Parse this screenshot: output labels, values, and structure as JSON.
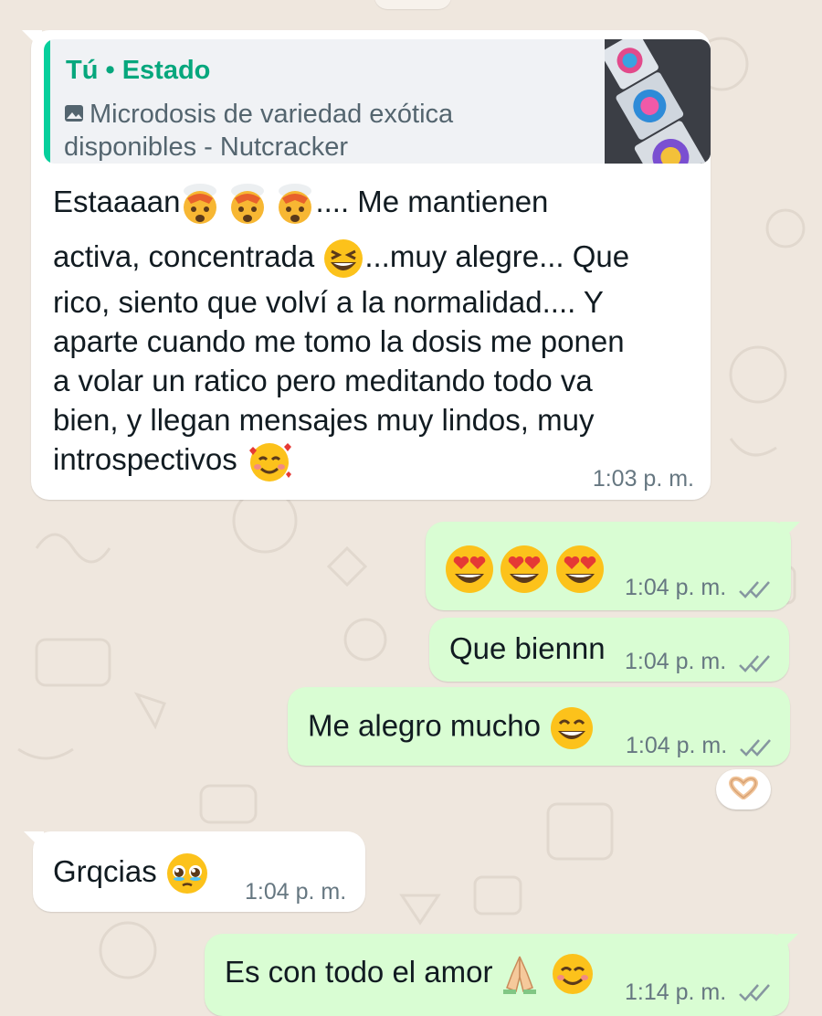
{
  "messages": {
    "m1": {
      "quote_author": "Tú • Estado",
      "quote_text_line1": "Microdosis de variedad exótica",
      "quote_text_line2": "disponibles - Nutcracker",
      "line1_a": "Estaaaan",
      "line1_b": ".... Me mantienen",
      "line2_a": "activa, concentrada ",
      "line2_b": "...muy alegre... Que",
      "line3": "rico, siento que volví a la normalidad.... Y",
      "line4": "aparte cuando me tomo la dosis me ponen",
      "line5": "a volar un ratico pero meditando todo va",
      "line6": "bien, y llegan mensajes muy lindos, muy",
      "line7": "introspectivos ",
      "time": "1:03 p. m."
    },
    "m2": {
      "time": "1:04 p. m."
    },
    "m3": {
      "text": "Que biennn",
      "time": "1:04 p. m."
    },
    "m4": {
      "text": "Me alegro mucho ",
      "time": "1:04 p. m."
    },
    "m5": {
      "text": "Grqcias ",
      "time": "1:04 p. m."
    },
    "m6": {
      "text": "Es con todo el amor ",
      "time": "1:14 p. m."
    }
  },
  "colors": {
    "wallpaper": "#efe7de",
    "incoming": "#ffffff",
    "outgoing": "#d9fdd3",
    "quote_accent": "#06cf9c",
    "tick": "#8696a0"
  },
  "icons": {
    "emoji_exploding_head": "exploding-head",
    "emoji_laughing": "grinning-squinting-face",
    "emoji_hearts": "smiling-face-with-hearts",
    "emoji_heart_eyes": "smiling-face-with-heart-eyes",
    "emoji_grin": "beaming-face",
    "emoji_pleading": "pleading-face",
    "emoji_pray": "folded-hands",
    "emoji_smile": "smiling-face-with-smiling-eyes",
    "reaction": "heart-hands"
  }
}
